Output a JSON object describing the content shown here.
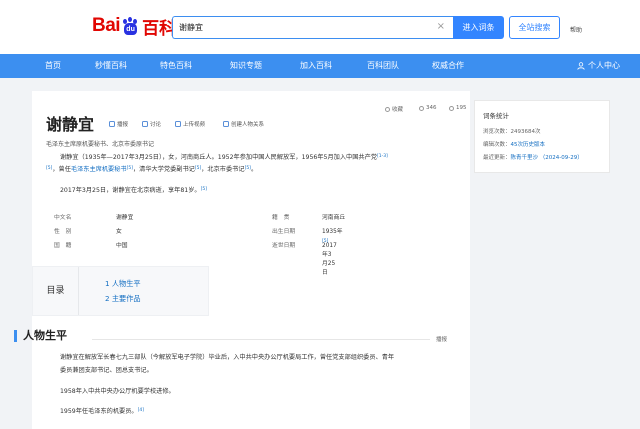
{
  "header": {
    "logo": {
      "bai": "Bai",
      "du": "du",
      "baike": "百科"
    },
    "search": {
      "value": "谢静宜",
      "clear": "×"
    },
    "enter_button": "进入词条",
    "site_search_button": "全站搜索",
    "help": "帮助"
  },
  "nav": {
    "items": [
      "首页",
      "秒懂百科",
      "特色百科",
      "知识专题",
      "加入百科",
      "百科团队",
      "权威合作"
    ],
    "user": "个人中心"
  },
  "entry": {
    "title": "谢静宜",
    "tools": [
      "播报",
      "讨论",
      "上传视频",
      "创建人物关系"
    ],
    "stats": {
      "collect": "收藏",
      "likes": "346",
      "shares": "195"
    },
    "subtitle": "毛泽东主席原机要秘书、北京市委原书记",
    "summary": {
      "line1_a": "谢静宜（1935年—2017年3月25日），女，河南商丘人。1952年参加中国人民解放军，1956年5月加入中国共产党",
      "line1_ref": "[1-3]",
      "line2_a": "，曾任",
      "line2_link": "毛泽东主席机要秘书",
      "line2_ref1": "[5]",
      "line2_b": "，清华大学党委副书记",
      "line2_ref2": "[5]",
      "line2_c": "，北京市委书记",
      "line2_ref3": "[5]",
      "line2_d": "。",
      "line2_ref0": "[5]",
      "line3": "2017年3月25日，谢静宜在北京病逝，享年81岁。",
      "line3_ref": "[5]"
    },
    "infobox": [
      {
        "k1": "中文名",
        "v1": "谢静宜",
        "k2": "籍　贯",
        "v2": "河南商丘"
      },
      {
        "k1": "性　别",
        "v1": "女",
        "k2": "出生日期",
        "v2": "1935年"
      },
      {
        "k1": "国　籍",
        "v1": "中国",
        "k2": "逝世日期",
        "v2": "2017年3月25日",
        "ref": "[5]"
      }
    ],
    "toc": {
      "label": "目录",
      "items": [
        "1  人物生平",
        "2  主要作品"
      ]
    },
    "section": {
      "title": "人物生平",
      "edit": "播报",
      "p1_a": "谢静宜在解放军长春七九三部队（今解放军电子学院）毕业后，入中共中央办公厅机要局工作，曾任党支部组织委员、青年",
      "p1_b": "委员兼团支部书记、团总支书记。",
      "p2": "1958年入中共中央办公厅机要学校进修。",
      "p3": "1959年任毛泽东的机要员。",
      "p3_ref": "[4]"
    }
  },
  "sidebar": {
    "title": "词条统计",
    "rows": [
      {
        "label": "浏览次数：",
        "value": "2493684次"
      },
      {
        "label": "编辑次数：",
        "value": "45次历史版本"
      },
      {
        "label": "最近更新：",
        "value": "陈青千里沙  （2024-09-29）"
      }
    ]
  },
  "colors": {
    "brand_red": "#e10602",
    "brand_blue": "#2932e1",
    "nav_blue": "#3c8ff0",
    "link": "#136ec2"
  }
}
